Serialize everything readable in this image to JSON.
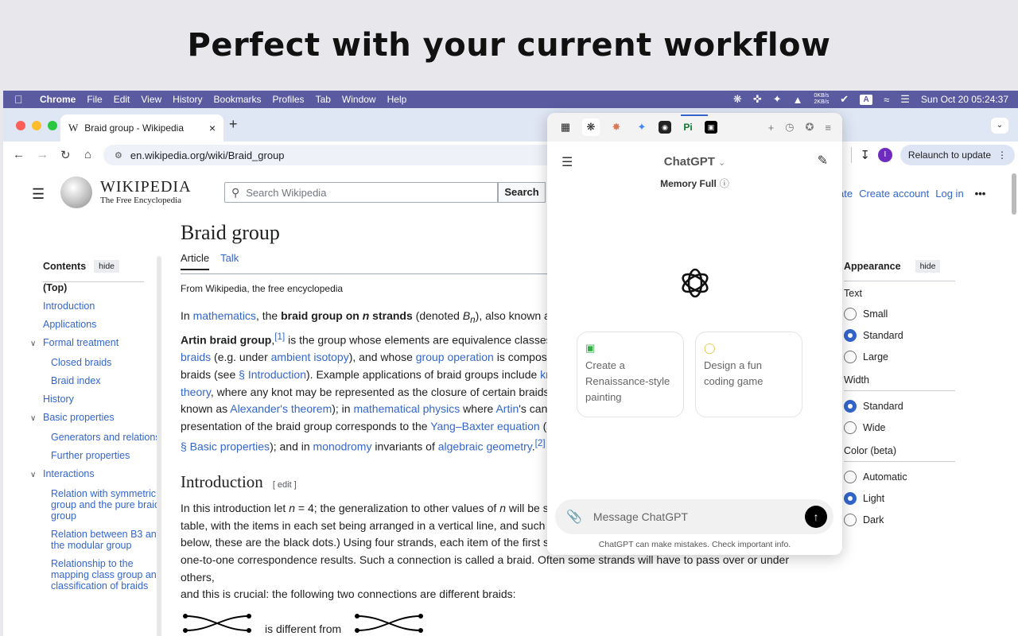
{
  "headline": "Perfect with your current workflow",
  "menubar": {
    "items": [
      "Chrome",
      "File",
      "Edit",
      "View",
      "History",
      "Bookmarks",
      "Profiles",
      "Tab",
      "Window",
      "Help"
    ],
    "net_up": "0KB/s",
    "net_down": "2KB/s",
    "input_source": "A",
    "clock": "Sun Oct 20  05:24:37"
  },
  "browser": {
    "tab_title": "Braid group - Wikipedia",
    "url": "en.wikipedia.org/wiki/Braid_group",
    "profile_initial": "I",
    "relaunch_label": "Relaunch to update"
  },
  "wiki": {
    "logo_title": "WIKIPEDIA",
    "logo_sub": "The Free Encyclopedia",
    "search_placeholder": "Search Wikipedia",
    "search_button": "Search",
    "links": [
      "ate",
      "Create account",
      "Log in"
    ],
    "toc": {
      "title": "Contents",
      "hide": "hide",
      "items": [
        {
          "label": "(Top)",
          "level": "top"
        },
        {
          "label": "Introduction",
          "level": "main"
        },
        {
          "label": "Applications",
          "level": "main"
        },
        {
          "label": "Formal treatment",
          "level": "main",
          "chev": true
        },
        {
          "label": "Closed braids",
          "level": "sub"
        },
        {
          "label": "Braid index",
          "level": "sub"
        },
        {
          "label": "History",
          "level": "main"
        },
        {
          "label": "Basic properties",
          "level": "main",
          "chev": true
        },
        {
          "label": "Generators and relations",
          "level": "sub"
        },
        {
          "label": "Further properties",
          "level": "sub"
        },
        {
          "label": "Interactions",
          "level": "main",
          "chev": true
        },
        {
          "label": "Relation with symmetric group and the pure braid group",
          "level": "sub"
        },
        {
          "label": "Relation between B3 and the modular group",
          "level": "sub"
        },
        {
          "label": "Relationship to the mapping class group and classification of braids",
          "level": "sub"
        }
      ]
    },
    "article": {
      "title": "Braid group",
      "tab_article": "Article",
      "tab_talk": "Talk",
      "from": "From Wikipedia, the free encyclopedia",
      "intro_heading": "Introduction",
      "edit": "[ edit ]",
      "para2_line4": "one-to-one correspondence results. Such a connection is called a braid. Often some strands will have to pass over or under others,",
      "para2_line5": "and this is crucial: the following two connections are different braids:",
      "braid_caption": "is different from"
    },
    "appearance": {
      "title": "Appearance",
      "hide": "hide",
      "text_label": "Text",
      "text_options": [
        {
          "label": "Small",
          "on": false
        },
        {
          "label": "Standard",
          "on": true
        },
        {
          "label": "Large",
          "on": false
        }
      ],
      "width_label": "Width",
      "width_options": [
        {
          "label": "Standard",
          "on": true
        },
        {
          "label": "Wide",
          "on": false
        }
      ],
      "color_label": "Color (beta)",
      "color_options": [
        {
          "label": "Automatic",
          "on": false
        },
        {
          "label": "Light",
          "on": true
        },
        {
          "label": "Dark",
          "on": false
        }
      ]
    }
  },
  "chatgpt": {
    "title": "ChatGPT",
    "memory": "Memory Full",
    "card1": "Create a Renaissance-style painting",
    "card2": "Design a fun coding game",
    "composer_placeholder": "Message ChatGPT",
    "disclaimer": "ChatGPT can make mistakes. Check important info."
  },
  "colors": {
    "accent": "#3366cc",
    "menubar": "#5a5aa0"
  }
}
